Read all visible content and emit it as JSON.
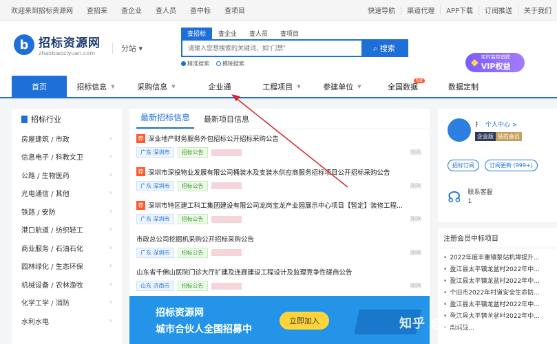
{
  "topbar": {
    "welcome": "欢迎来到招标资源网",
    "links": [
      "查招采",
      "查企业",
      "查人员",
      "查中标",
      "查项目"
    ],
    "right": [
      "快速导航",
      "渠道代理",
      "APP下载",
      "订阅推送",
      "关于我们"
    ]
  },
  "logo": {
    "mark": "b",
    "name": "招标资源网",
    "url": "zhaobiaoziyuan.com"
  },
  "substation": "分站",
  "search": {
    "tabs": [
      "查招标",
      "查企业",
      "查人员",
      "查项目"
    ],
    "placeholder": "请输入您想搜索的关键词，如\"门禁\"",
    "button": "搜索",
    "options": [
      "精准搜索",
      "模糊搜索"
    ]
  },
  "vip": {
    "line1": "实时监控追踪",
    "line2": "VIP权益"
  },
  "nav": {
    "items": [
      "首页",
      "招标信息",
      "采购信息",
      "企业通",
      "工程项目",
      "参建单位",
      "全国数据",
      "数据定制"
    ],
    "hot": "hot"
  },
  "sidebar": {
    "title": "招标行业",
    "items": [
      "房屋建筑 / 市政",
      "信息电子 / 科教文卫",
      "公路 / 生物医药",
      "光电通信 / 其他",
      "铁路 / 安防",
      "港口航道 / 纺织轻工",
      "商业服务 / 石油石化",
      "园林绿化 / 生态环保",
      "机械设备 / 农林渔牧",
      "化学工学 / 消防",
      "水利水电"
    ]
  },
  "main": {
    "tabs": [
      "最新招标信息",
      "最新项目信息"
    ],
    "tag": "荐",
    "rows": [
      {
        "title": "深业地产财务服务外包招标公开招标采购公告",
        "region": "广东 深圳市",
        "type": "招标公告",
        "date": "刚刚",
        "tagged": true
      },
      {
        "title": "深圳市深投物业发展有限公司桶装水及支装水供应商服务招标项目公开招标采购公告",
        "region": "广东 深圳市",
        "type": "招标公告",
        "date": "刚刚",
        "tagged": true
      },
      {
        "title": "深圳市特区建工科工集团建设有限公司龙岗宝龙产业园展示中心项目【暂定】装修工程...",
        "region": "广东 深圳市",
        "type": "招标公告",
        "date": "刚刚",
        "tagged": true
      },
      {
        "title": "市政总公司挖掘机采购公开招标采购公告",
        "region": "广东 深圳市",
        "type": "招标公告",
        "date": "刚刚",
        "tagged": false
      },
      {
        "title": "山东省千佛山医院门诊大厅扩建及连廊建设工程设计及监理竞争性磋商公告",
        "region": "山东 济南市",
        "type": "招标公告",
        "date": "刚刚",
        "tagged": false
      }
    ],
    "banner": {
      "line1": "招标资源网",
      "line2": "城市合伙人全国招募中",
      "button": "立即加入"
    }
  },
  "user": {
    "name": "扌",
    "center": "个人中心 >",
    "badge1": "企业版",
    "badge2": "钻石会员",
    "btn1": "招标订阅",
    "btn2": "订阅更新 (999+)",
    "service_title": "联系客服",
    "service_phone": "1"
  },
  "wins": {
    "title": "注册会员中标项目",
    "items": [
      "2022年度丰重镇泵站机埠提升...",
      "盈江县太平镇龙盆村2022年中...",
      "盈江县太平镇龙盆村2022年中...",
      "个旧市2022年村道安全生命防...",
      "盈江县太平镇龙盆村2022年中...",
      "盈江县太平镇龙盆村2022年中...",
      "南涧县..."
    ]
  },
  "watermark": "知乎 @招标资源网"
}
